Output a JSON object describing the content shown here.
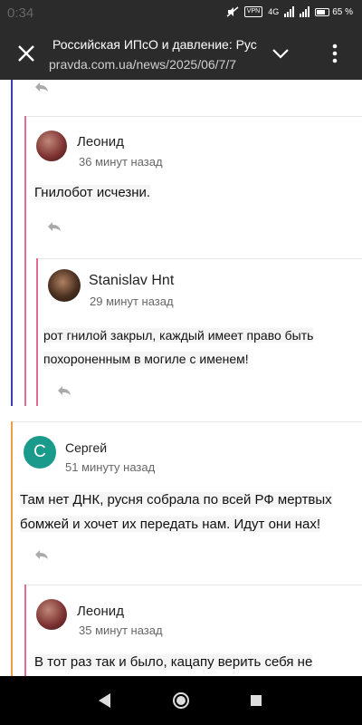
{
  "status_bar": {
    "time": "0:34",
    "network_label": "VPN",
    "signal_label": "4G",
    "battery": "65 %"
  },
  "toolbar": {
    "title": "Российская ИПсО и давление: Рус",
    "url": "pravda.com.ua/news/2025/06/7/7"
  },
  "comments": [
    {
      "author": "Леонид",
      "time": "36 минут назад",
      "text": "Гнилобот исчезни.",
      "avatar_color": "#7a2f2f"
    },
    {
      "author": "Stanislav Hnt",
      "time": "29 минут назад",
      "text_lines": [
        "рот гнилой закрыл, каждый имеет право быть",
        "похороненным в могиле с именем!"
      ],
      "avatar_color": "#4a3020"
    },
    {
      "author": "Сергей",
      "time": "51 минуту назад",
      "text_lines": [
        "Там нет ДНК, русня собрала по всей РФ мертвых",
        "бомжей и хочет их передать нам. Идут они нах!"
      ],
      "avatar_letter": "С",
      "avatar_color": "#1a9a8a"
    },
    {
      "author": "Леонид",
      "time": "35 минут назад",
      "text": "В тот раз так и было, кацапу верить себя не",
      "avatar_color": "#7a2f2f"
    }
  ],
  "colors": {
    "thread_blue": "#3b3fb0",
    "thread_pink": "#e46a9a",
    "thread_orange": "#f0a040"
  },
  "icons": [
    "close-icon",
    "chevron-down-icon",
    "more-vert-icon",
    "reply-icon",
    "back-icon",
    "home-icon",
    "recents-icon"
  ]
}
